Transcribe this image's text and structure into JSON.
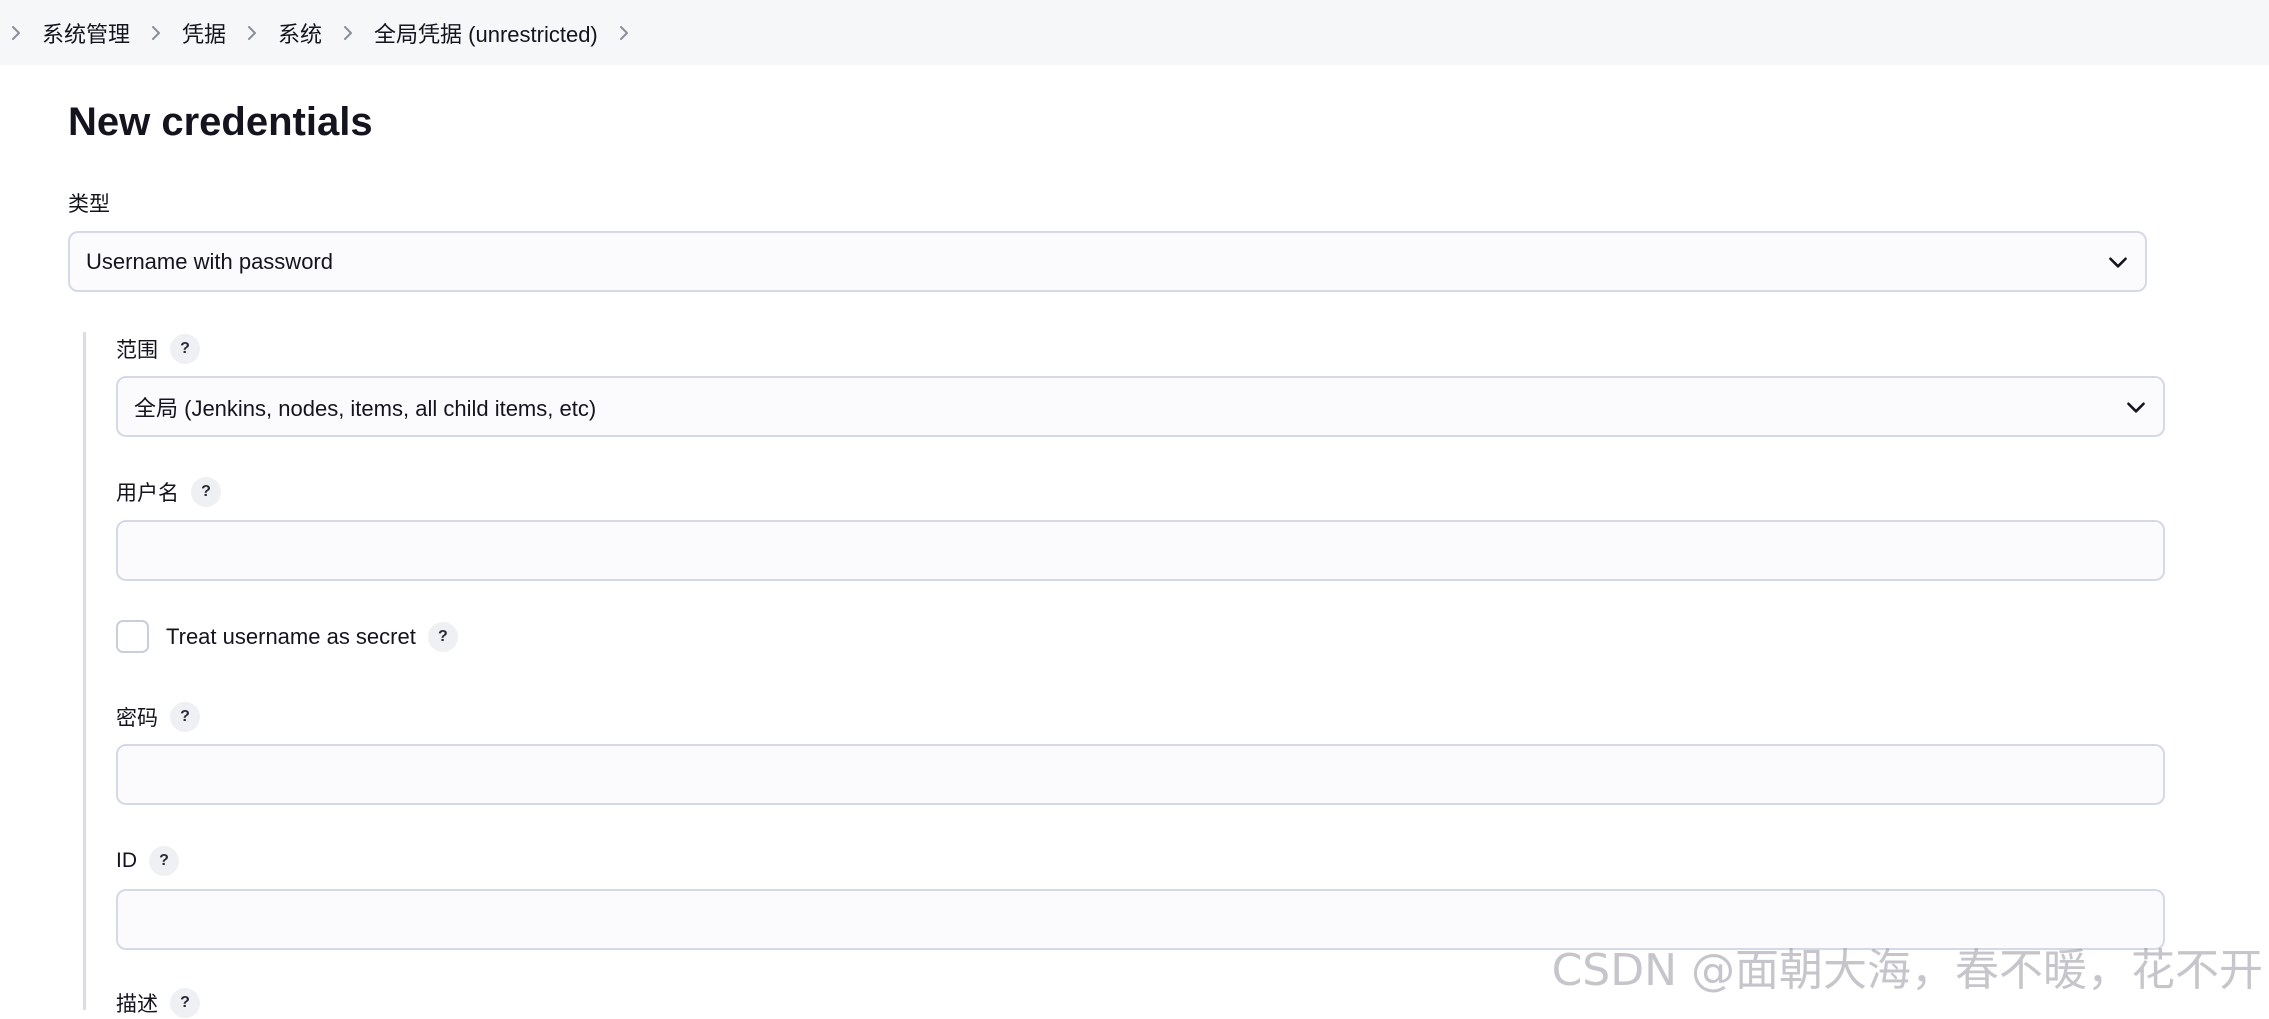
{
  "breadcrumb": {
    "items": [
      {
        "label": "系统管理"
      },
      {
        "label": "凭据"
      },
      {
        "label": "系统"
      },
      {
        "label": "全局凭据 (unrestricted)"
      }
    ]
  },
  "page": {
    "title": "New credentials"
  },
  "form": {
    "kind": {
      "label": "类型",
      "value": "Username with password"
    },
    "scope": {
      "label": "范围",
      "value": "全局 (Jenkins, nodes, items, all child items, etc)"
    },
    "username": {
      "label": "用户名",
      "value": ""
    },
    "treat_secret": {
      "label": "Treat username as secret",
      "checked": false
    },
    "password": {
      "label": "密码",
      "value": ""
    },
    "id": {
      "label": "ID",
      "value": ""
    },
    "description": {
      "label": "描述"
    },
    "help_symbol": "?"
  },
  "watermark": {
    "text": "CSDN @面朝大海，春不暖，花不开"
  },
  "icons": {
    "breadcrumb_separator": "chevron-right-icon",
    "select_indicator": "chevron-down-icon",
    "help": "help-icon"
  },
  "colors": {
    "breadcrumb_bg": "#f6f7f9",
    "input_border": "#d4dae5",
    "text": "#14141f",
    "help_bg": "#eef0f4"
  }
}
